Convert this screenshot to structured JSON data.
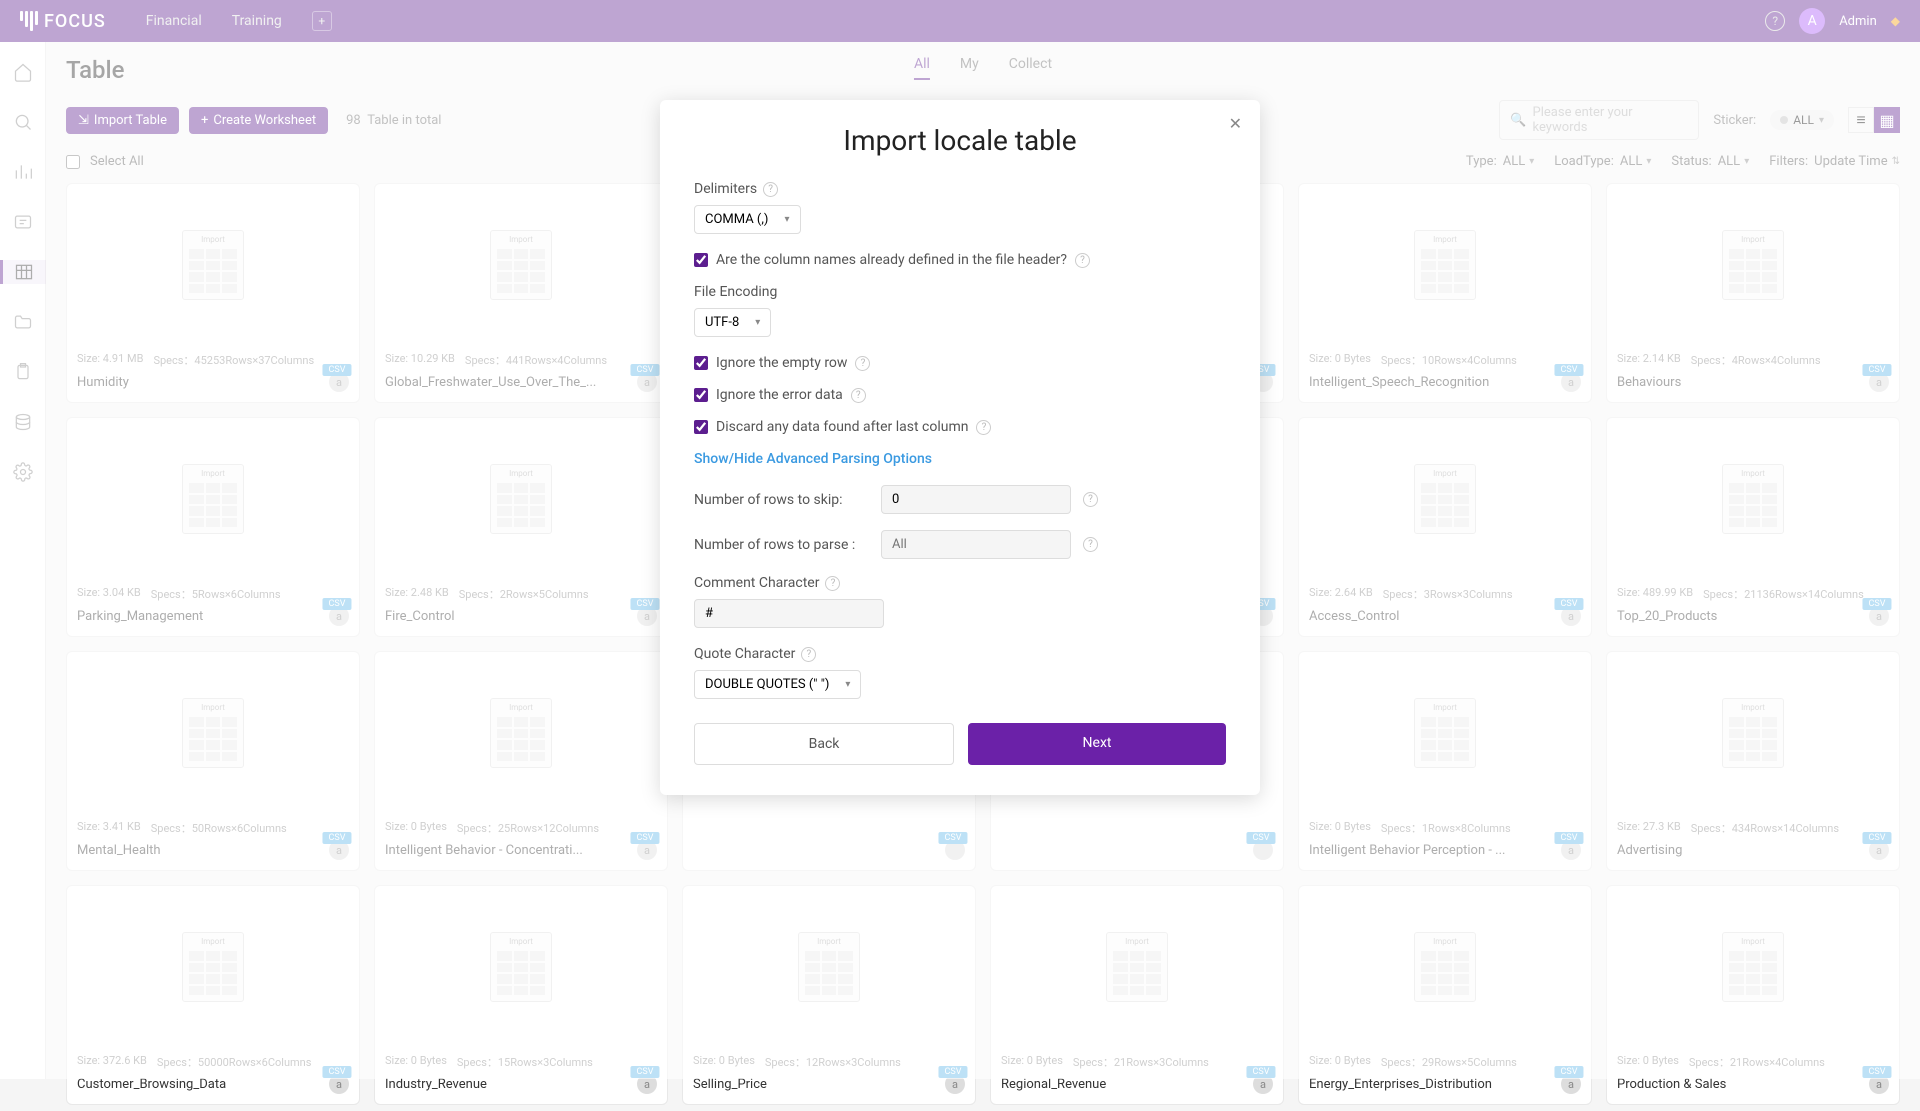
{
  "topbar": {
    "logo": "FOCUS",
    "nav": [
      "Financial",
      "Training"
    ],
    "admin_label": "Admin"
  },
  "page": {
    "title": "Table",
    "tabs": [
      "All",
      "My",
      "Collect"
    ],
    "active_tab": 0,
    "import_btn": "Import Table",
    "create_btn": "Create Worksheet",
    "count_num": "98",
    "count_label": "Table in total",
    "search_placeholder": "Please enter your keywords",
    "sticker_label": "Sticker:",
    "sticker_value": "ALL",
    "select_all": "Select All",
    "filters": [
      {
        "label": "Type:",
        "value": "ALL"
      },
      {
        "label": "LoadType:",
        "value": "ALL"
      },
      {
        "label": "Status:",
        "value": "ALL"
      },
      {
        "label": "Filters:",
        "value": "Update Time"
      }
    ]
  },
  "cards": [
    {
      "size": "Size: 4.91 MB",
      "specs": "Specs：45253Rows×37Columns",
      "name": "Humidity",
      "owner": "a"
    },
    {
      "size": "Size: 10.29 KB",
      "specs": "Specs：441Rows×4Columns",
      "name": "Global_Freshwater_Use_Over_The_...",
      "owner": "a"
    },
    {
      "size": "",
      "specs": "",
      "name": "",
      "owner": ""
    },
    {
      "size": "",
      "specs": "",
      "name": "",
      "owner": ""
    },
    {
      "size": "Size: 0 Bytes",
      "specs": "Specs：10Rows×4Columns",
      "name": "Intelligent_Speech_Recognition",
      "owner": "a"
    },
    {
      "size": "Size: 2.14 KB",
      "specs": "Specs：4Rows×4Columns",
      "name": "Behaviours",
      "owner": "a"
    },
    {
      "size": "Size: 3.04 KB",
      "specs": "Specs：5Rows×6Columns",
      "name": "Parking_Management",
      "owner": "a"
    },
    {
      "size": "Size: 2.48 KB",
      "specs": "Specs：2Rows×5Columns",
      "name": "Fire_Control",
      "owner": "a"
    },
    {
      "size": "",
      "specs": "",
      "name": "",
      "owner": ""
    },
    {
      "size": "",
      "specs": "",
      "name": "",
      "owner": ""
    },
    {
      "size": "Size: 2.64 KB",
      "specs": "Specs：3Rows×3Columns",
      "name": "Access_Control",
      "owner": "a"
    },
    {
      "size": "Size: 489.99 KB",
      "specs": "Specs：21136Rows×14Columns",
      "name": "Top_20_Products",
      "owner": "a"
    },
    {
      "size": "Size: 3.41 KB",
      "specs": "Specs：50Rows×6Columns",
      "name": "Mental_Health",
      "owner": "a"
    },
    {
      "size": "Size: 0 Bytes",
      "specs": "Specs：25Rows×12Columns",
      "name": "Intelligent Behavior - Concentrati...",
      "owner": "a"
    },
    {
      "size": "",
      "specs": "",
      "name": "",
      "owner": ""
    },
    {
      "size": "",
      "specs": "",
      "name": "",
      "owner": ""
    },
    {
      "size": "Size: 0 Bytes",
      "specs": "Specs：1Rows×8Columns",
      "name": "Intelligent Behavior Perception - ...",
      "owner": "a"
    },
    {
      "size": "Size: 27.3 KB",
      "specs": "Specs：434Rows×14Columns",
      "name": "Advertising",
      "owner": "a"
    },
    {
      "size": "Size: 372.6 KB",
      "specs": "Specs：50000Rows×6Columns",
      "name": "Customer_Browsing_Data",
      "owner": "a"
    },
    {
      "size": "Size: 0 Bytes",
      "specs": "Specs：15Rows×3Columns",
      "name": "Industry_Revenue",
      "owner": "a"
    },
    {
      "size": "Size: 0 Bytes",
      "specs": "Specs：12Rows×3Columns",
      "name": "Selling_Price",
      "owner": "a"
    },
    {
      "size": "Size: 0 Bytes",
      "specs": "Specs：21Rows×3Columns",
      "name": "Regional_Revenue",
      "owner": "a"
    },
    {
      "size": "Size: 0 Bytes",
      "specs": "Specs：29Rows×5Columns",
      "name": "Energy_Enterprises_Distribution",
      "owner": "a"
    },
    {
      "size": "Size: 0 Bytes",
      "specs": "Specs：21Rows×4Columns",
      "name": "Production & Sales",
      "owner": "a"
    }
  ],
  "modal": {
    "title": "Import locale table",
    "labels": {
      "delimiters": "Delimiters",
      "header_q": "Are the column names already defined in the file header?",
      "encoding": "File Encoding",
      "ignore_empty": "Ignore the empty row",
      "ignore_error": "Ignore the error data",
      "discard": "Discard any data found after last column",
      "advanced": "Show/Hide Advanced Parsing Options",
      "skip": "Number of rows to skip:",
      "parse": "Number of rows to parse :",
      "comment": "Comment Character",
      "quote": "Quote Character"
    },
    "values": {
      "delimiter": "COMMA (,)",
      "encoding": "UTF-8",
      "skip": "0",
      "parse_placeholder": "All",
      "comment": "#",
      "quote": "DOUBLE QUOTES (\" \")"
    },
    "buttons": {
      "back": "Back",
      "next": "Next"
    }
  }
}
